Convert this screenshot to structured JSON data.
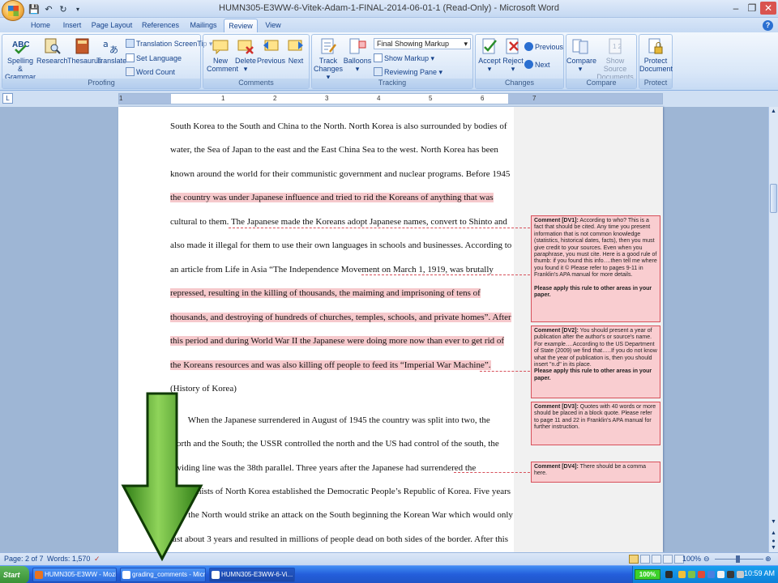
{
  "window": {
    "title": "HUMN305-E3WW-6-Vitek-Adam-1-FINAL-2014-06-01-1 (Read-Only) - Microsoft Word"
  },
  "ribbon_tabs": [
    "Home",
    "Insert",
    "Page Layout",
    "References",
    "Mailings",
    "Review",
    "View"
  ],
  "active_tab": "Review",
  "ribbon": {
    "proofing": {
      "label": "Proofing",
      "spelling": "Spelling &",
      "grammar": "Grammar",
      "research": "Research",
      "thesaurus": "Thesaurus",
      "translate": "Translate",
      "translation_screentip": "Translation ScreenTip",
      "set_language": "Set Language",
      "word_count": "Word Count"
    },
    "comments": {
      "label": "Comments",
      "new": "New",
      "comment": "Comment",
      "delete": "Delete",
      "previous": "Previous",
      "next": "Next"
    },
    "tracking": {
      "label": "Tracking",
      "track": "Track",
      "changes": "Changes",
      "balloons": "Balloons",
      "final_showing_markup": "Final Showing Markup",
      "show_markup": "Show Markup",
      "reviewing_pane": "Reviewing Pane"
    },
    "changes": {
      "label": "Changes",
      "accept": "Accept",
      "reject": "Reject",
      "previous": "Previous",
      "next": "Next"
    },
    "compare": {
      "label": "Compare",
      "compare": "Compare",
      "show_source": "Show Source",
      "documents": "Documents"
    },
    "protect": {
      "label": "Protect",
      "protect": "Protect",
      "document": "Document"
    }
  },
  "ruler_numbers": [
    "1",
    "1",
    "2",
    "3",
    "4",
    "5",
    "6",
    "7"
  ],
  "document": {
    "lines": [
      {
        "text": "South Korea to the South and China to the North. North Korea is also surrounded by bodies of",
        "highlight": false
      },
      {
        "text": "water, the Sea of Japan to the east and the East China Sea to the west. North Korea has been",
        "highlight": false
      },
      {
        "text": "known around the world for their communistic government and nuclear programs.  Before 1945",
        "highlight": false
      },
      {
        "text": "the country was under Japanese influence and tried to rid the Koreans of anything that was",
        "highlight": true
      },
      {
        "text": "cultural to them. The Japanese made the Koreans adopt Japanese names, convert to Shinto and",
        "highlight": false
      },
      {
        "text": "also made it illegal for them to use their own languages in schools and businesses.  According to",
        "highlight": false
      },
      {
        "text": "an article from Life in Asia “The Independence Movement on March 1, 1919, was brutally",
        "highlight": false
      },
      {
        "text": "repressed, resulting in the killing of thousands, the maiming and imprisoning of tens of",
        "highlight": true
      },
      {
        "text": "thousands, and destroying of hundreds of churches, temples, schools, and private homes”. After",
        "highlight": true
      },
      {
        "text": "this period and during World War II the Japanese were doing more now than ever to get rid of",
        "highlight": true
      },
      {
        "text": "the Koreans resources and was also killing off people to feed its “Imperial War Machine”.",
        "highlight": true
      },
      {
        "text": "(History of Korea)",
        "highlight": false
      },
      {
        "text": "        When the Japanese surrendered in August of 1945 the country was split into two, the",
        "highlight": false
      },
      {
        "text": "North and the South; the USSR controlled the north and the US had control of the south, the",
        "highlight": false
      },
      {
        "text": "dividing line was the 38th parallel.  Three years after the Japanese had surrendered the",
        "highlight": false
      },
      {
        "text": "communists of North Korea established the Democratic People’s Republic of Korea. Five years",
        "highlight": false
      },
      {
        "text": "later the North would strike an attack on the South beginning the Korean War which would only",
        "highlight": false
      },
      {
        "text": "last about 3 years and resulted in millions of people dead on both sides of the border. After this",
        "highlight": false
      }
    ]
  },
  "comments": [
    {
      "label": "Comment [DV1]:",
      "body": "According to who? This is a fact that should be cited. Any time you present information that is not common knowledge (statistics, historical dates, facts), then you must give credit to your sources. Even when you paraphrase, you must cite. Here is a good rule of thumb: if you found this info….then tell me where you found it © Please refer to pages 9-11 in Franklin's APA manual for more details.",
      "bold_note": "Please apply this rule to other areas in your paper."
    },
    {
      "label": "Comment [DV2]:",
      "body": "You should present a year of publication after the author's or source's name. For example….According to the US Department of State (2009) we find that…..If you do not know what the year of publication is, then you should insert \"n.d\" in its place.",
      "bold_note": "Please apply this rule to other areas in your paper."
    },
    {
      "label": "Comment [DV3]:",
      "body": "Quotes with 40 words or more should be placed in a block quote. Please refer to page 11 and 22 in Franklin's APA manual for further instruction.",
      "bold_note": ""
    },
    {
      "label": "Comment [DV4]:",
      "body": "There should be a comma here.",
      "bold_note": ""
    }
  ],
  "status": {
    "page": "Page: 2 of 7",
    "words": "Words: 1,570",
    "zoom": "100%"
  },
  "taskbar": {
    "start": "Start",
    "items": [
      "HUMN305-E3WW - Mozil...",
      "grading_comments - Micr...",
      "HUMN305-E3WW-6-Vi..."
    ],
    "battery": "100%",
    "clock": "10:59 AM"
  },
  "colors": {
    "comment_fill": "#f9cdd0",
    "comment_border": "#d7505a",
    "highlight": "#f6c9cc",
    "arrow_green": "#4fae2a"
  }
}
